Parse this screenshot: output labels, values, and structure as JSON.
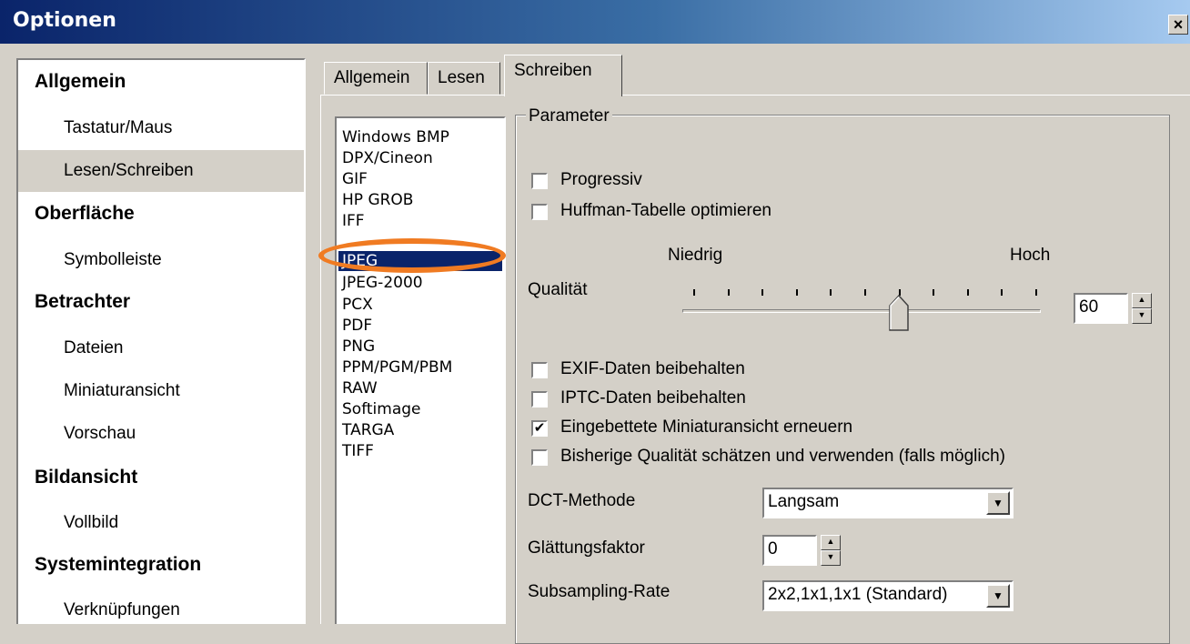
{
  "window": {
    "title": "Optionen",
    "close_label": "×"
  },
  "nav": {
    "categories": [
      {
        "label": "Allgemein",
        "items": [
          "Tastatur/Maus",
          "Lesen/Schreiben"
        ]
      },
      {
        "label": "Oberfläche",
        "items": [
          "Symbolleiste"
        ]
      },
      {
        "label": "Betrachter",
        "items": [
          "Dateien",
          "Miniaturansicht",
          "Vorschau"
        ]
      },
      {
        "label": "Bildansicht",
        "items": [
          "Vollbild"
        ]
      },
      {
        "label": "Systemintegration",
        "items": [
          "Verknüpfungen"
        ]
      }
    ],
    "selected_item": "Lesen/Schreiben"
  },
  "tabs": {
    "items": [
      "Allgemein",
      "Lesen",
      "Schreiben"
    ],
    "active": "Schreiben"
  },
  "formats": {
    "items": [
      "Windows BMP",
      "DPX/Cineon",
      "GIF",
      "HP GROB",
      "IFF",
      "JPEG",
      "JPEG-2000",
      "PCX",
      "PDF",
      "PNG",
      "PPM/PGM/PBM",
      "RAW",
      "Softimage",
      "TARGA",
      "TIFF"
    ],
    "selected": "JPEG"
  },
  "params": {
    "group_label": "Parameter",
    "progressive_label": "Progressiv",
    "progressive_checked": false,
    "huffman_label": "Huffman-Tabelle optimieren",
    "huffman_checked": false,
    "quality_label": "Qualität",
    "quality_low": "Niedrig",
    "quality_high": "Hoch",
    "quality_value": "60",
    "quality_level": 0.6,
    "exif_label": "EXIF-Daten beibehalten",
    "exif_checked": false,
    "iptc_label": "IPTC-Daten beibehalten",
    "iptc_checked": false,
    "thumb_label": "Eingebettete Miniaturansicht erneuern",
    "thumb_checked": true,
    "estimate_label": "Bisherige Qualität schätzen und verwenden (falls möglich)",
    "estimate_checked": false,
    "dct_label": "DCT-Methode",
    "dct_value": "Langsam",
    "smoothing_label": "Glättungsfaktor",
    "smoothing_value": "0",
    "subsampling_label": "Subsampling-Rate",
    "subsampling_value": "2x2,1x1,1x1 (Standard)"
  },
  "colors": {
    "selection": "#0a246a",
    "highlight_ring": "#f07b22",
    "face": "#d4d0c8"
  }
}
